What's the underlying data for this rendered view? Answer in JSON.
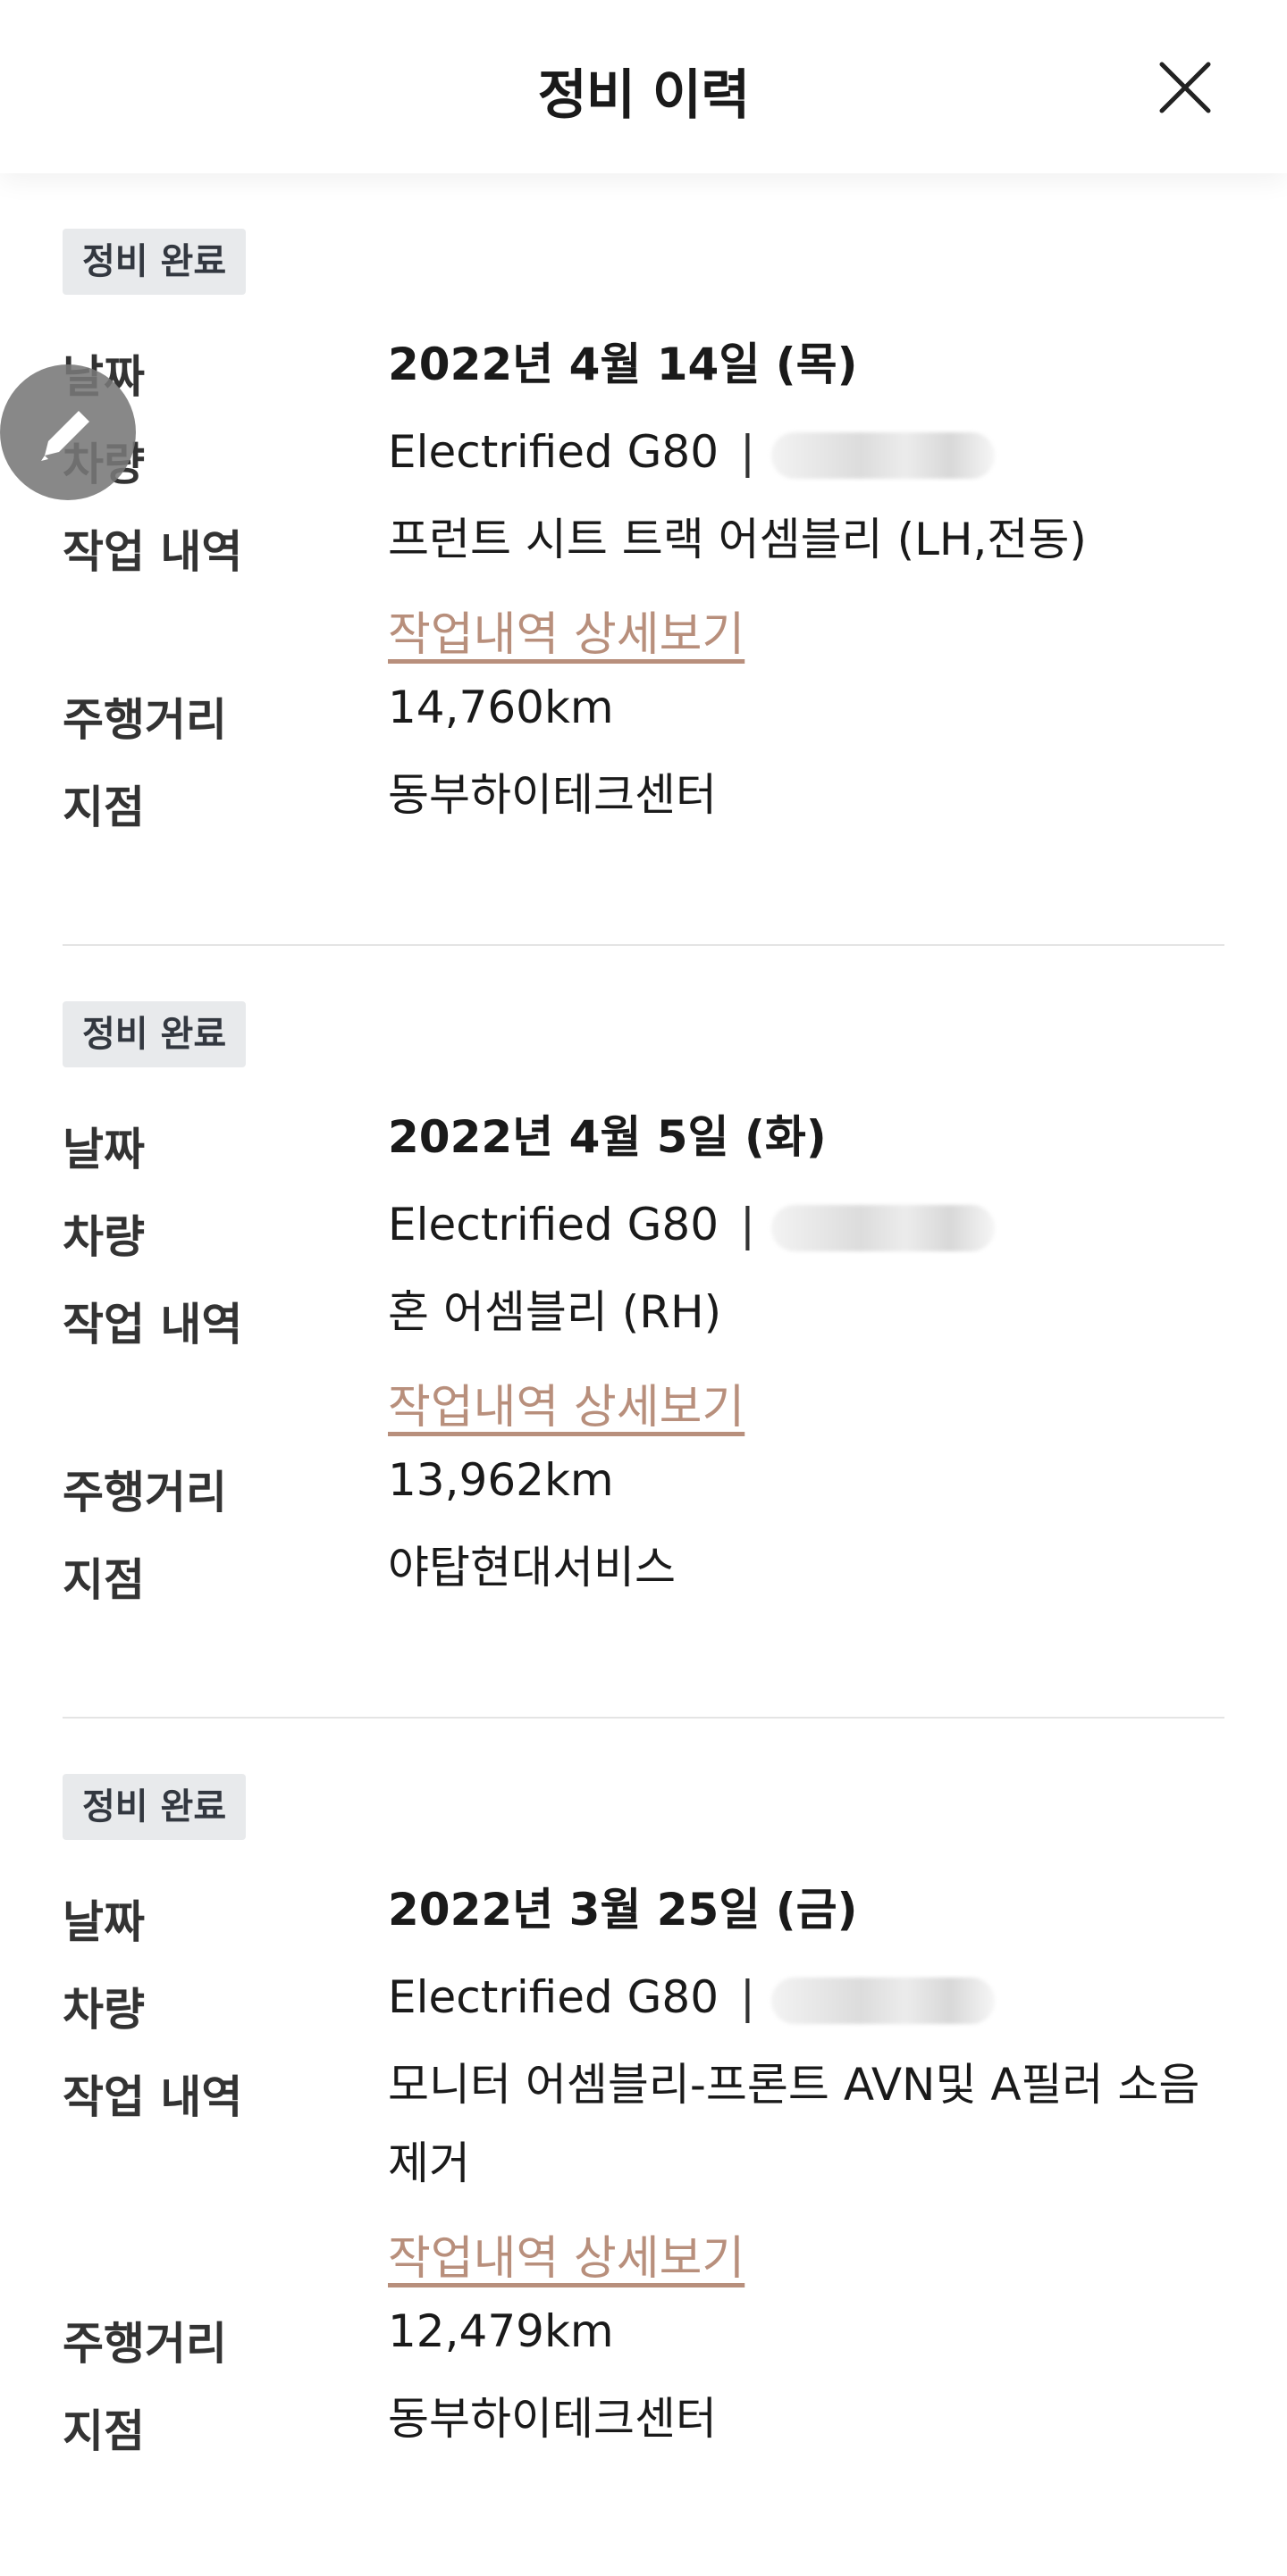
{
  "header": {
    "title": "정비 이력",
    "close_icon": "close-icon"
  },
  "fab": {
    "icon": "pencil-icon"
  },
  "records": [
    {
      "status": "정비 완료",
      "labels": {
        "date": "날짜",
        "vehicle": "차량",
        "work": "작업 내역",
        "mileage": "주행거리",
        "branch": "지점"
      },
      "date": "2022년 4월 14일 (목)",
      "vehicle": "Electrified G80",
      "work": "프런트 시트 트랙 어셈블리 (LH,전동)",
      "detail_link": "작업내역 상세보기",
      "mileage": "14,760km",
      "branch": "동부하이테크센터"
    },
    {
      "status": "정비 완료",
      "labels": {
        "date": "날짜",
        "vehicle": "차량",
        "work": "작업 내역",
        "mileage": "주행거리",
        "branch": "지점"
      },
      "date": "2022년 4월 5일 (화)",
      "vehicle": "Electrified G80",
      "work": "혼 어셈블리 (RH)",
      "detail_link": "작업내역 상세보기",
      "mileage": "13,962km",
      "branch": "야탑현대서비스"
    },
    {
      "status": "정비 완료",
      "labels": {
        "date": "날짜",
        "vehicle": "차량",
        "work": "작업 내역",
        "mileage": "주행거리",
        "branch": "지점"
      },
      "date": "2022년 3월 25일 (금)",
      "vehicle": "Electrified G80",
      "work": "모니터 어셈블리-프론트 AVN및 A필러 소음제거",
      "detail_link": "작업내역 상세보기",
      "mileage": "12,479km",
      "branch": "동부하이테크센터"
    }
  ],
  "colors": {
    "link": "#b88f7c",
    "badge_bg": "#e8eaec",
    "divider": "#e4e4e4"
  }
}
